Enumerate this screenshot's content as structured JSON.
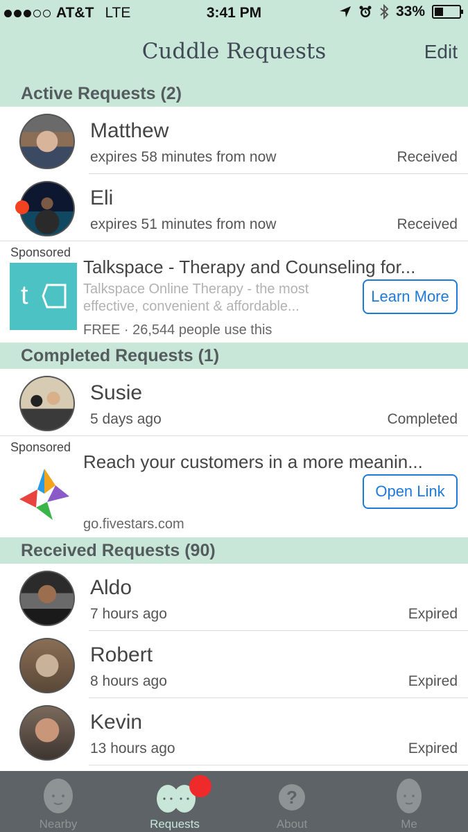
{
  "status_bar": {
    "carrier": "AT&T",
    "network": "LTE",
    "time": "3:41 PM",
    "battery": "33%"
  },
  "nav": {
    "title": "Cuddle Requests",
    "edit": "Edit"
  },
  "sections": {
    "active": "Active Requests (2)",
    "completed": "Completed Requests (1)",
    "received": "Received Requests (90)"
  },
  "active": [
    {
      "name": "Matthew",
      "sub": "expires 58 minutes from now",
      "status": "Received"
    },
    {
      "name": "Eli",
      "sub": "expires 51 minutes from now",
      "status": "Received"
    }
  ],
  "ad1": {
    "sponsored": "Sponsored",
    "title": "Talkspace - Therapy and Counseling for...",
    "desc": "Talkspace Online Therapy - the most effective, convenient & affordable...",
    "meta": "FREE · 26,544 people use this",
    "button": "Learn More",
    "logo_text": "t"
  },
  "completed": [
    {
      "name": "Susie",
      "sub": "5 days ago",
      "status": "Completed"
    }
  ],
  "ad2": {
    "sponsored": "Sponsored",
    "title": "Reach your customers in a more meanin...",
    "meta": "go.fivestars.com",
    "button": "Open Link"
  },
  "received": [
    {
      "name": "Aldo",
      "sub": "7 hours ago",
      "status": "Expired"
    },
    {
      "name": "Robert",
      "sub": "8 hours ago",
      "status": "Expired"
    },
    {
      "name": "Kevin",
      "sub": "13 hours ago",
      "status": "Expired"
    }
  ],
  "tabs": [
    {
      "label": "Nearby"
    },
    {
      "label": "Requests"
    },
    {
      "label": "About"
    },
    {
      "label": "Me"
    }
  ],
  "colors": {
    "mint": "#c8e7d9",
    "tab_bar": "#5e6367",
    "accent_blue": "#1e7ad9",
    "badge_red": "#ee2a2a",
    "talkspace_teal": "#4cc2c4"
  }
}
